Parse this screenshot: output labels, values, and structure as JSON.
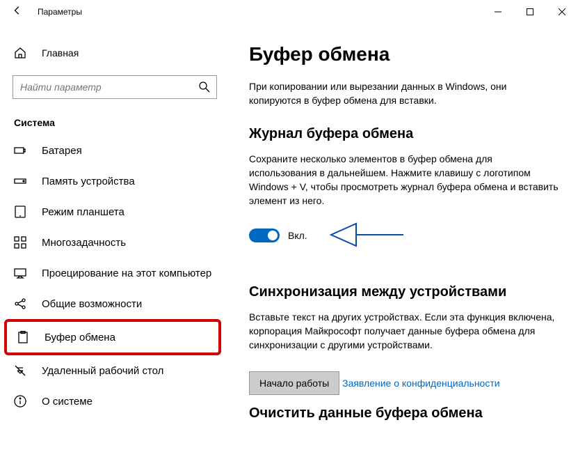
{
  "titlebar": {
    "title": "Параметры"
  },
  "sidebar": {
    "home_label": "Главная",
    "search_placeholder": "Найти параметр",
    "section_title": "Система",
    "items": [
      {
        "label": "Батарея"
      },
      {
        "label": "Память устройства"
      },
      {
        "label": "Режим планшета"
      },
      {
        "label": "Многозадачность"
      },
      {
        "label": "Проецирование на этот компьютер"
      },
      {
        "label": "Общие возможности"
      },
      {
        "label": "Буфер обмена"
      },
      {
        "label": "Удаленный рабочий стол"
      },
      {
        "label": "О системе"
      }
    ]
  },
  "main": {
    "title": "Буфер обмена",
    "intro": "При копировании или вырезании данных в Windows, они копируются в буфер обмена для вставки.",
    "history": {
      "heading": "Журнал буфера обмена",
      "desc": "Сохраните несколько элементов в буфер обмена для использования в дальнейшем. Нажмите клавишу с логотипом Windows + V, чтобы просмотреть журнал буфера обмена и вставить элемент из него.",
      "toggle_state": "Вкл."
    },
    "sync": {
      "heading": "Синхронизация между устройствами",
      "desc": "Вставьте текст на других устройствах. Если эта функция включена, корпорация Майкрософт получает данные буфера обмена для синхронизации с другими устройствами.",
      "button_label": "Начало работы"
    },
    "privacy_link": "Заявление о конфиденциальности",
    "clear": {
      "heading": "Очистить данные буфера обмена"
    }
  }
}
